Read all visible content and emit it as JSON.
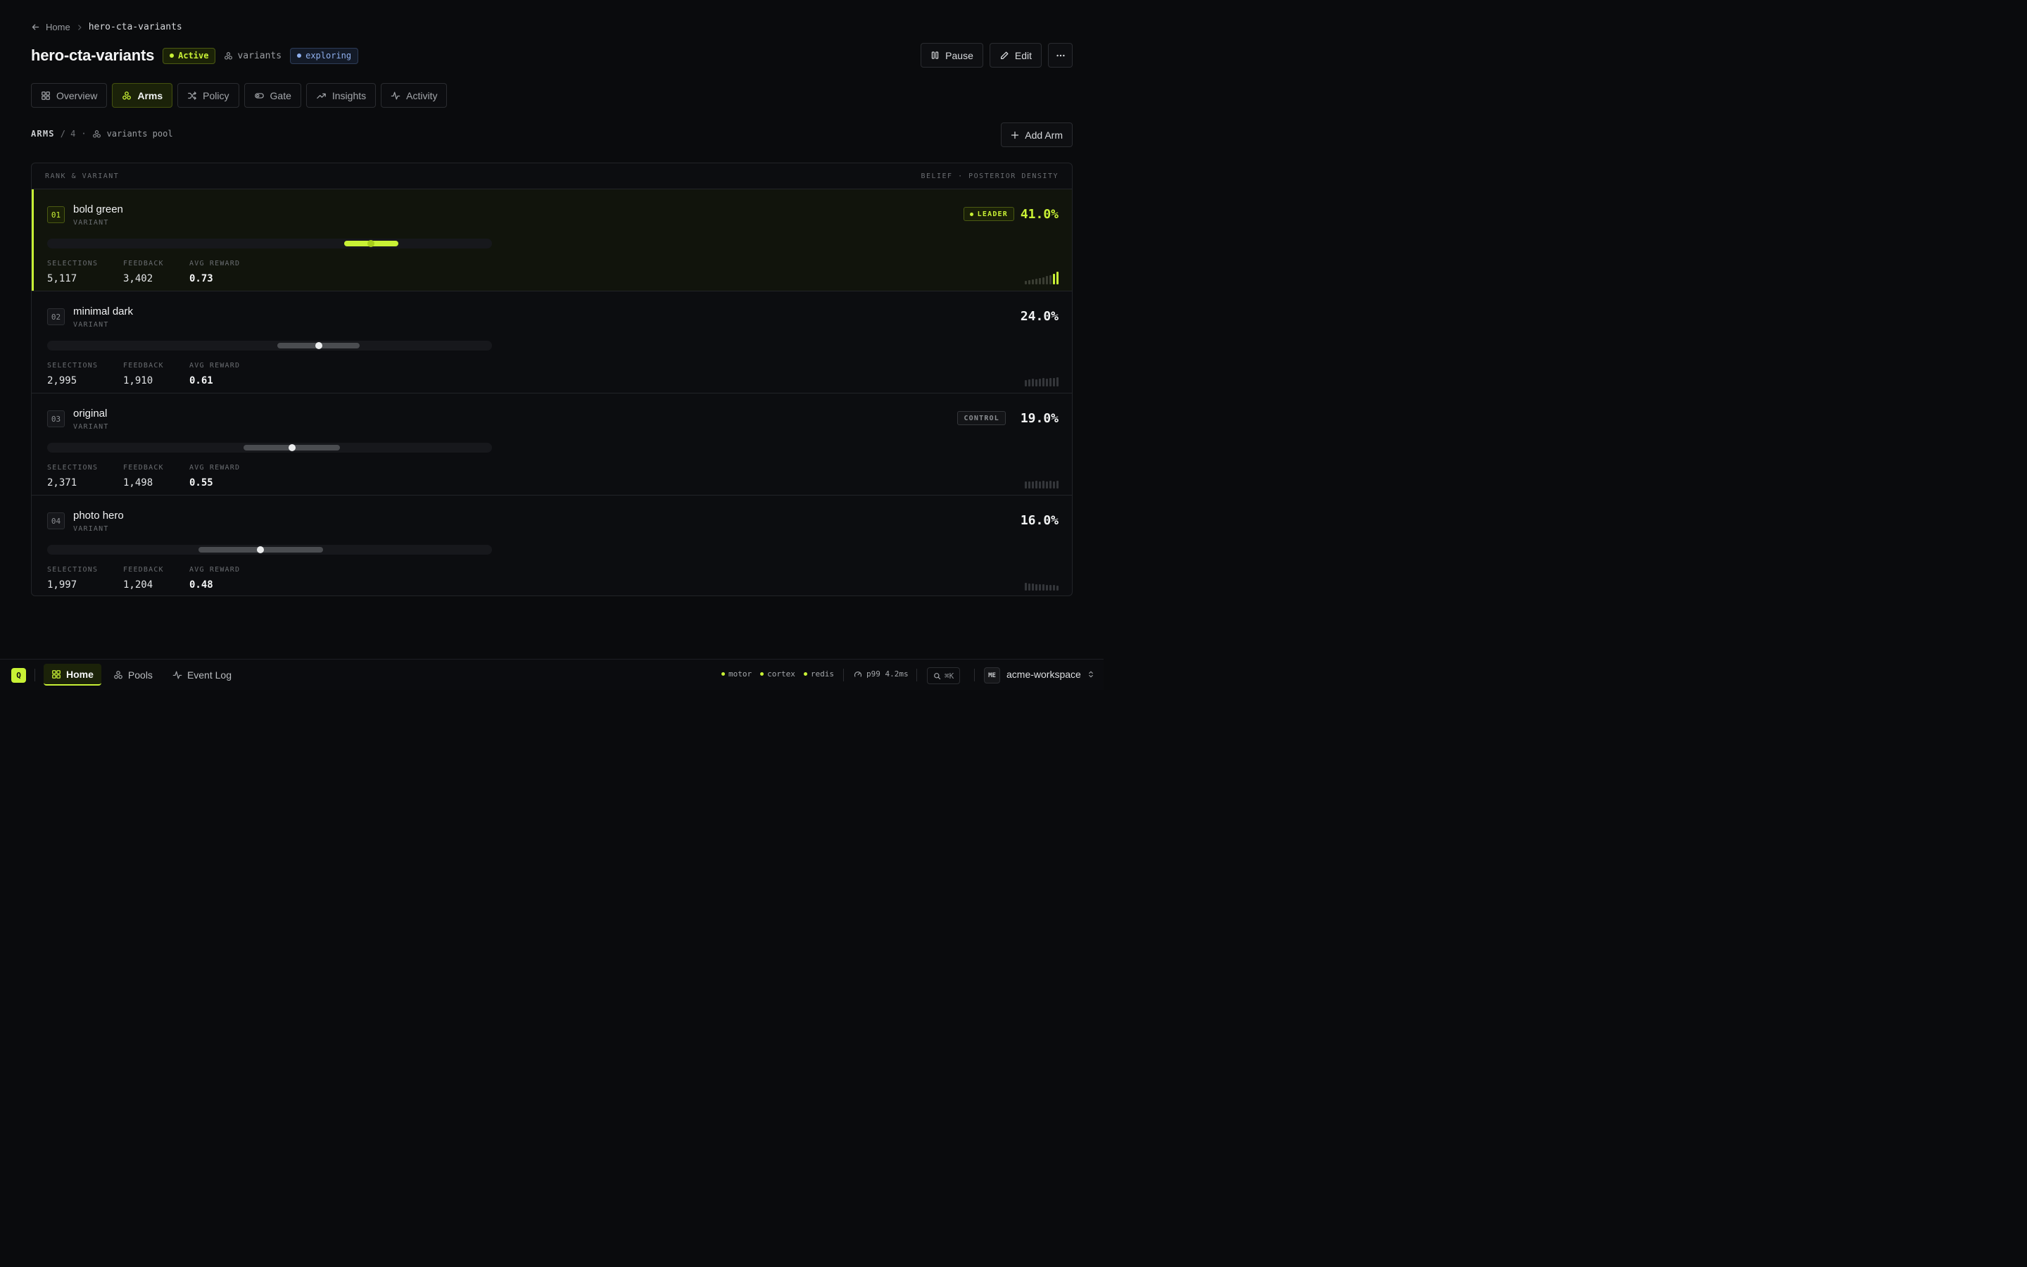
{
  "breadcrumb": {
    "home": "Home",
    "current": "hero-cta-variants"
  },
  "header": {
    "title": "hero-cta-variants",
    "status": "Active",
    "pool": "variants",
    "mode": "exploring",
    "actions": {
      "pause": "Pause",
      "edit": "Edit"
    }
  },
  "tabs": [
    {
      "label": "Overview",
      "icon": "grid-icon"
    },
    {
      "label": "Arms",
      "icon": "arms-icon",
      "active": true
    },
    {
      "label": "Policy",
      "icon": "shuffle-icon"
    },
    {
      "label": "Gate",
      "icon": "toggle-icon"
    },
    {
      "label": "Insights",
      "icon": "trend-icon"
    },
    {
      "label": "Activity",
      "icon": "pulse-icon"
    }
  ],
  "section": {
    "title": "ARMS",
    "count": "/ 4",
    "sep": "·",
    "pool": "variants pool",
    "add_button": "Add Arm"
  },
  "table": {
    "col_left": "RANK & VARIANT",
    "col_right": "BELIEF · POSTERIOR DENSITY",
    "stat_labels": {
      "selections": "SELECTIONS",
      "feedback": "FEEDBACK",
      "avg_reward": "AVG REWARD"
    },
    "rows": [
      {
        "rank": "01",
        "name": "bold green",
        "type": "VARIANT",
        "tag": "LEADER",
        "share": "41.0%",
        "selections": "5,117",
        "feedback": "3,402",
        "avg_reward": "0.73",
        "belief": {
          "low": 0.667,
          "high": 0.79,
          "mean": 0.728
        }
      },
      {
        "rank": "02",
        "name": "minimal dark",
        "type": "VARIANT",
        "tag": "",
        "share": "24.0%",
        "selections": "2,995",
        "feedback": "1,910",
        "avg_reward": "0.61",
        "belief": {
          "low": 0.517,
          "high": 0.703,
          "mean": 0.61
        }
      },
      {
        "rank": "03",
        "name": "original",
        "type": "VARIANT",
        "tag": "CONTROL",
        "share": "19.0%",
        "selections": "2,371",
        "feedback": "1,498",
        "avg_reward": "0.55",
        "belief": {
          "low": 0.441,
          "high": 0.658,
          "mean": 0.55
        }
      },
      {
        "rank": "04",
        "name": "photo hero",
        "type": "VARIANT",
        "tag": "",
        "share": "16.0%",
        "selections": "1,997",
        "feedback": "1,204",
        "avg_reward": "0.48",
        "belief": {
          "low": 0.34,
          "high": 0.62,
          "mean": 0.48
        }
      }
    ]
  },
  "bottom_bar": {
    "logo": "Q",
    "nav": [
      {
        "label": "Home",
        "icon": "grid-icon",
        "active": true
      },
      {
        "label": "Pools",
        "icon": "arms-icon"
      },
      {
        "label": "Event Log",
        "icon": "pulse-icon"
      }
    ],
    "services": [
      "motor",
      "cortex",
      "redis"
    ],
    "latency": "p99 4.2ms",
    "shortcut": "⌘K",
    "avatar": "ME",
    "workspace": "acme-workspace"
  },
  "colors": {
    "accent": "#c8f135",
    "background": "#0a0b0d",
    "explore": "#8fb0ee"
  }
}
